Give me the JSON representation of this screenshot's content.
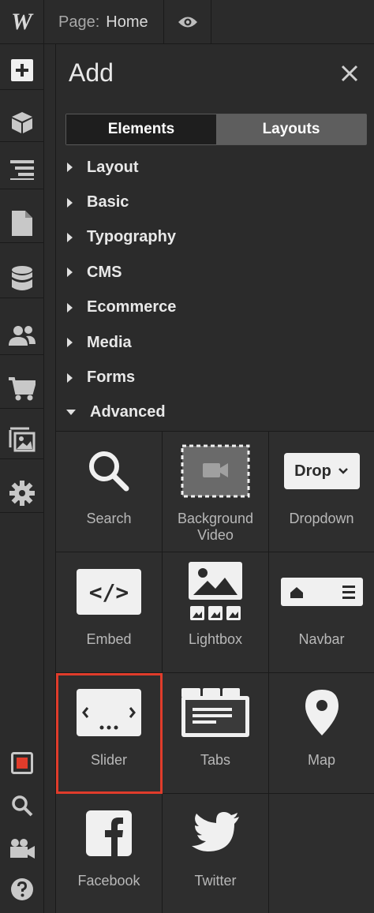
{
  "topbar": {
    "logo": "W",
    "page_label": "Page:",
    "page_name": "Home"
  },
  "panel": {
    "title": "Add",
    "tabs": [
      {
        "label": "Elements",
        "active": true
      },
      {
        "label": "Layouts",
        "active": false
      }
    ],
    "categories": [
      {
        "label": "Layout",
        "expanded": false
      },
      {
        "label": "Basic",
        "expanded": false
      },
      {
        "label": "Typography",
        "expanded": false
      },
      {
        "label": "CMS",
        "expanded": false
      },
      {
        "label": "Ecommerce",
        "expanded": false
      },
      {
        "label": "Media",
        "expanded": false
      },
      {
        "label": "Forms",
        "expanded": false
      },
      {
        "label": "Advanced",
        "expanded": true
      }
    ],
    "elements": [
      {
        "label": "Search",
        "icon": "search-icon"
      },
      {
        "label": "Background Video",
        "icon": "background-video-icon"
      },
      {
        "label": "Dropdown",
        "icon": "dropdown-icon",
        "icon_text": "Drop"
      },
      {
        "label": "Embed",
        "icon": "embed-icon",
        "icon_text": "</>"
      },
      {
        "label": "Lightbox",
        "icon": "lightbox-icon"
      },
      {
        "label": "Navbar",
        "icon": "navbar-icon"
      },
      {
        "label": "Slider",
        "icon": "slider-icon",
        "highlighted": true
      },
      {
        "label": "Tabs",
        "icon": "tabs-icon"
      },
      {
        "label": "Map",
        "icon": "map-pin-icon"
      },
      {
        "label": "Facebook",
        "icon": "facebook-icon"
      },
      {
        "label": "Twitter",
        "icon": "twitter-icon"
      }
    ]
  },
  "colors": {
    "highlight": "#e03c2b",
    "background": "#2b2b2b"
  }
}
